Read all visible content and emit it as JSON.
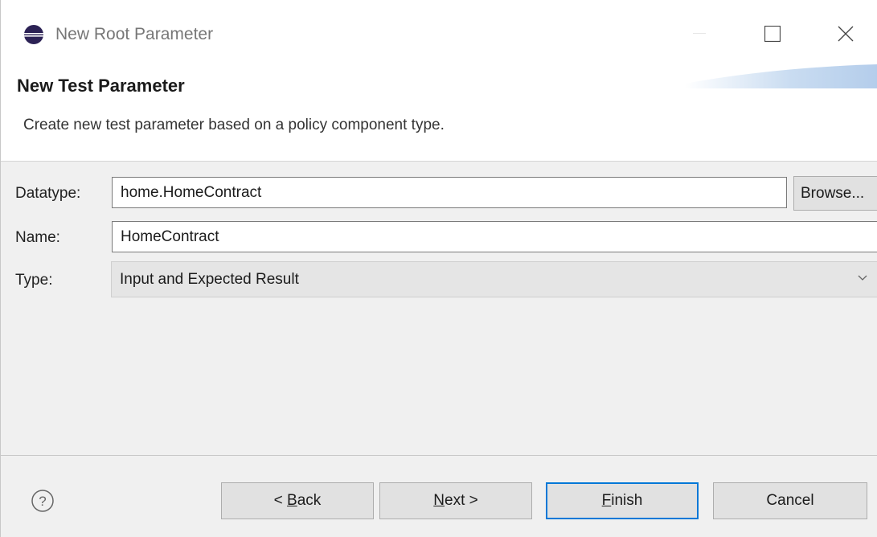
{
  "window": {
    "title": "New Root Parameter",
    "icon": "eclipse-icon",
    "controls": [
      "minimize-icon",
      "maximize-icon",
      "close-icon"
    ]
  },
  "header": {
    "title": "New Test Parameter",
    "description": "Create new test parameter based on a policy component type."
  },
  "form": {
    "datatype": {
      "label": "Datatype:",
      "value": "home.HomeContract",
      "browse_label": "Browse..."
    },
    "name": {
      "label": "Name:",
      "value": "HomeContract"
    },
    "type": {
      "label": "Type:",
      "selected": "Input and Expected Result"
    }
  },
  "footer": {
    "help_icon": "question-circle-icon",
    "back": {
      "prefix": "< ",
      "mnemonic": "B",
      "rest": "ack"
    },
    "next": {
      "mnemonic": "N",
      "rest": "ext >"
    },
    "finish": {
      "mnemonic": "F",
      "rest": "inish"
    },
    "cancel": "Cancel"
  },
  "colors": {
    "accent": "#0078d7",
    "header_background": "#ffffff",
    "dialog_background": "#f0f0f0"
  }
}
